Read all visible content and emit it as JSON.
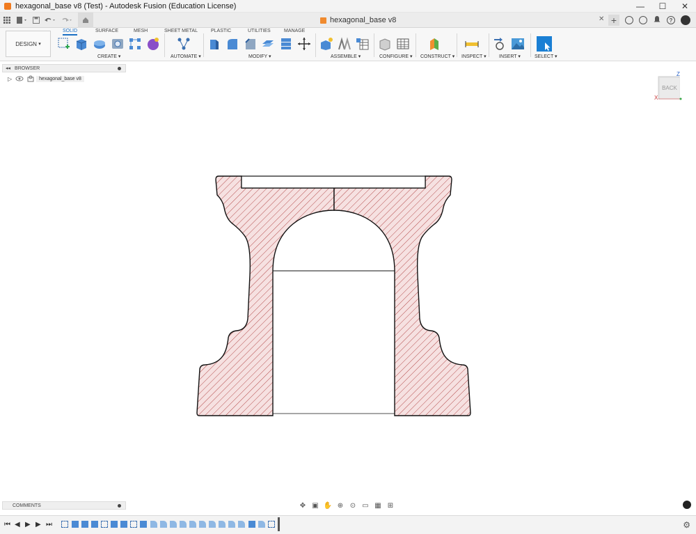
{
  "window": {
    "title": "hexagonal_base v8 (Test) - Autodesk Fusion (Education License)",
    "controls": {
      "minimize": "—",
      "maximize": "☐",
      "close": "✕"
    }
  },
  "document_tab": {
    "label": "hexagonal_base v8",
    "close": "✕"
  },
  "qat": {
    "new_tab": "+"
  },
  "ribbon": {
    "workspace": "DESIGN",
    "tabs": [
      "SOLID",
      "SURFACE",
      "MESH",
      "SHEET METAL",
      "PLASTIC",
      "UTILITIES",
      "MANAGE"
    ],
    "active_tab": "SOLID",
    "groups": [
      "CREATE",
      "AUTOMATE",
      "MODIFY",
      "ASSEMBLE",
      "CONFIGURE",
      "CONSTRUCT",
      "INSPECT",
      "INSERT",
      "SELECT"
    ]
  },
  "browser": {
    "title": "BROWSER",
    "items": [
      {
        "label": "hexagonal_base v8"
      }
    ]
  },
  "viewcube": {
    "face": "BACK",
    "axis_z": "Z",
    "axis_x": "X"
  },
  "comments": {
    "title": "COMMENTS"
  },
  "colors": {
    "accent": "#1a6fc4",
    "hatch_fill": "#f5dcdc",
    "hatch_line": "#b02a2a",
    "outline": "#111111"
  }
}
